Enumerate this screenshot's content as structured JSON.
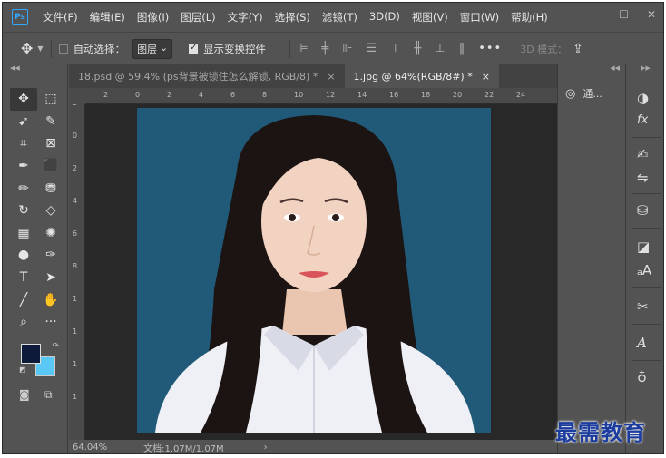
{
  "app": {
    "logo_text": "Ps"
  },
  "menu": [
    "文件(F)",
    "编辑(E)",
    "图像(I)",
    "图层(L)",
    "文字(Y)",
    "选择(S)",
    "滤镜(T)",
    "3D(D)",
    "视图(V)",
    "窗口(W)",
    "帮助(H)"
  ],
  "window_controls": {
    "minimize": "—",
    "maximize": "☐",
    "close": "✕"
  },
  "options_bar": {
    "auto_select_label": "自动选择：",
    "auto_select_checked": false,
    "target_value": "图层",
    "show_transform_label": "显示变换控件",
    "show_transform_checked": true,
    "more_label": "•••",
    "mode_3d_label": "3D 模式："
  },
  "tabs": [
    {
      "label": "18.psd @ 59.4% (ps背景被锁住怎么解锁, RGB/8) *",
      "active": false
    },
    {
      "label": "1.jpg @ 64%(RGB/8#) *",
      "active": true
    }
  ],
  "ruler_h_ticks": [
    "2",
    "0",
    "2",
    "4",
    "6",
    "8",
    "10",
    "12",
    "14",
    "16",
    "18",
    "20",
    "22",
    "24"
  ],
  "ruler_v_ticks": [
    "2",
    "0",
    "2",
    "4",
    "6",
    "8",
    "1",
    "1",
    "1",
    "1"
  ],
  "tools": [
    {
      "name": "move-tool",
      "glyph": "✥",
      "selected": true
    },
    {
      "name": "marquee-tool",
      "glyph": "⬚"
    },
    {
      "name": "lasso-tool",
      "glyph": "➹"
    },
    {
      "name": "quick-select-tool",
      "glyph": "✎"
    },
    {
      "name": "crop-tool",
      "glyph": "⌗"
    },
    {
      "name": "frame-tool",
      "glyph": "⊠"
    },
    {
      "name": "eyedropper-tool",
      "glyph": "✒"
    },
    {
      "name": "patch-tool",
      "glyph": "⬛"
    },
    {
      "name": "brush-tool",
      "glyph": "✏"
    },
    {
      "name": "stamp-tool",
      "glyph": "⛃"
    },
    {
      "name": "history-brush-tool",
      "glyph": "↻"
    },
    {
      "name": "eraser-tool",
      "glyph": "◇"
    },
    {
      "name": "gradient-tool",
      "glyph": "▦"
    },
    {
      "name": "blur-tool",
      "glyph": "✺"
    },
    {
      "name": "dodge-tool",
      "glyph": "●"
    },
    {
      "name": "pen-tool",
      "glyph": "✑"
    },
    {
      "name": "type-tool",
      "glyph": "T"
    },
    {
      "name": "path-select-tool",
      "glyph": "➤"
    },
    {
      "name": "line-tool",
      "glyph": "╱"
    },
    {
      "name": "hand-tool",
      "glyph": "✋"
    },
    {
      "name": "zoom-tool",
      "glyph": "⌕"
    },
    {
      "name": "more-tools",
      "glyph": "···"
    }
  ],
  "colors": {
    "foreground": "#0d1a3a",
    "background": "#5ac8f5",
    "photo_background": "#205a78"
  },
  "status_bar": {
    "zoom": "64.04%",
    "doc_info": "文档:1.07M/1.07M",
    "arrow": "›"
  },
  "right_panel": {
    "channels_label": "通..."
  },
  "watermark": "最需教育"
}
